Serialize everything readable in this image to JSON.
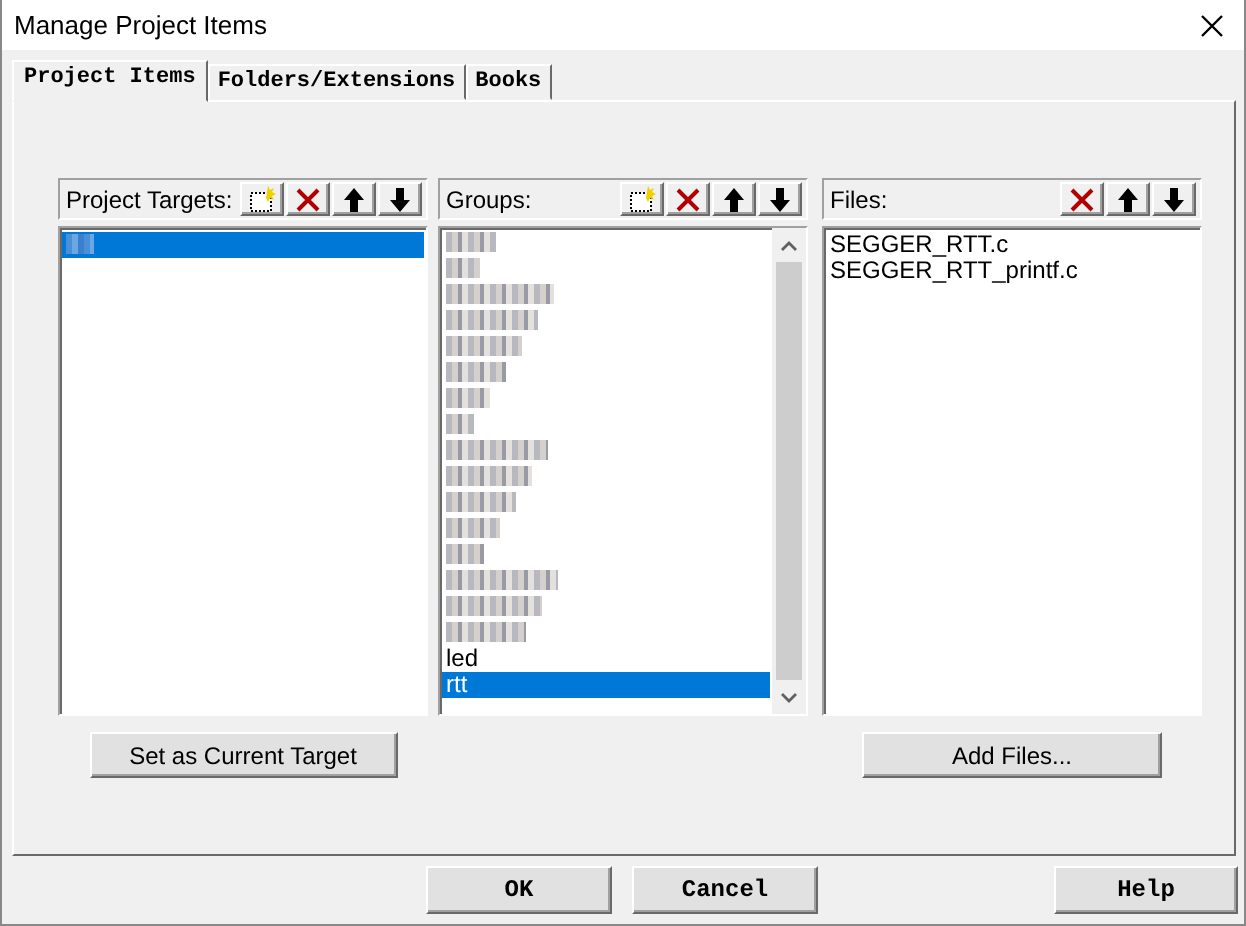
{
  "window": {
    "title": "Manage Project Items"
  },
  "tabs": [
    {
      "label": "Project Items",
      "selected": true
    },
    {
      "label": "Folders/Extensions",
      "selected": false
    },
    {
      "label": "Books",
      "selected": false
    }
  ],
  "panels": [
    {
      "title": "Project Targets:",
      "tools": [
        {
          "kind": "new"
        },
        {
          "kind": "delete"
        },
        {
          "kind": "up"
        },
        {
          "kind": "down"
        }
      ],
      "scrollbar": false,
      "items": [
        {
          "kind": "pixelated",
          "selected": true
        }
      ],
      "button": "Set as Current Target"
    },
    {
      "title": "Groups:",
      "tools": [
        {
          "kind": "new"
        },
        {
          "kind": "delete"
        },
        {
          "kind": "up"
        },
        {
          "kind": "down"
        }
      ],
      "scrollbar": true,
      "items": [
        {
          "kind": "pixelated",
          "selected": false
        },
        {
          "kind": "pixelated",
          "selected": false
        },
        {
          "kind": "pixelated",
          "selected": false
        },
        {
          "kind": "pixelated",
          "selected": false
        },
        {
          "kind": "pixelated",
          "selected": false
        },
        {
          "kind": "pixelated",
          "selected": false
        },
        {
          "kind": "pixelated",
          "selected": false
        },
        {
          "kind": "pixelated",
          "selected": false
        },
        {
          "kind": "pixelated",
          "selected": false
        },
        {
          "kind": "pixelated",
          "selected": false
        },
        {
          "kind": "pixelated",
          "selected": false
        },
        {
          "kind": "pixelated",
          "selected": false
        },
        {
          "kind": "pixelated",
          "selected": false
        },
        {
          "kind": "pixelated",
          "selected": false
        },
        {
          "kind": "pixelated",
          "selected": false
        },
        {
          "kind": "pixelated",
          "selected": false
        },
        {
          "kind": "text",
          "label": "led",
          "selected": false
        },
        {
          "kind": "text",
          "label": "rtt",
          "selected": true
        }
      ]
    },
    {
      "title": "Files:",
      "tools": [
        {
          "kind": "delete"
        },
        {
          "kind": "up"
        },
        {
          "kind": "down"
        }
      ],
      "scrollbar": false,
      "items": [
        {
          "kind": "text",
          "label": "SEGGER_RTT.c",
          "selected": false
        },
        {
          "kind": "text",
          "label": "SEGGER_RTT_printf.c",
          "selected": false
        }
      ],
      "button": "Add Files..."
    }
  ],
  "buttons": [
    {
      "label": "OK"
    },
    {
      "label": "Cancel"
    },
    {
      "label": "Help"
    }
  ]
}
